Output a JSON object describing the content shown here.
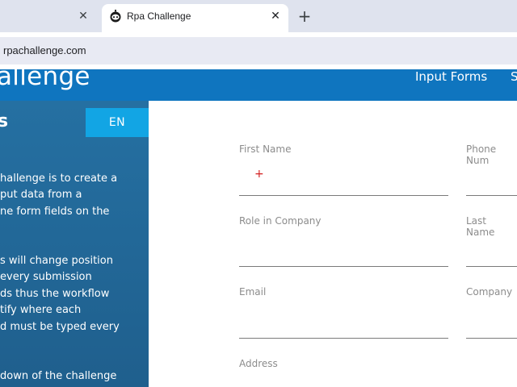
{
  "browser": {
    "tab_title": "Rpa Challenge",
    "url": "rpachallenge.com",
    "close_glyph": "✕",
    "new_tab_glyph": "+"
  },
  "header": {
    "logo_text": "allenge",
    "nav_input_forms": "Input Forms",
    "nav_next": "S"
  },
  "sidebar": {
    "title": "s",
    "language_button": "EN",
    "lines": [
      "hallenge is to create a",
      "put data from a",
      "ne form fields on the",
      "s will change position",
      "every submission",
      "ds thus the workflow",
      "tify where each",
      "d must be typed every",
      "down of the challenge"
    ]
  },
  "form": {
    "labels": {
      "first_name": "First Name",
      "phone_number": "Phone Num",
      "role_in_company": "Role in Company",
      "last_name": "Last Name",
      "email": "Email",
      "company": "Company",
      "address": "Address"
    }
  },
  "colors": {
    "header_bg": "#0f75bf",
    "sidebar_bg": "#2570a2",
    "en_button_bg": "#12a5e4",
    "cursor": "#d21f1f"
  }
}
